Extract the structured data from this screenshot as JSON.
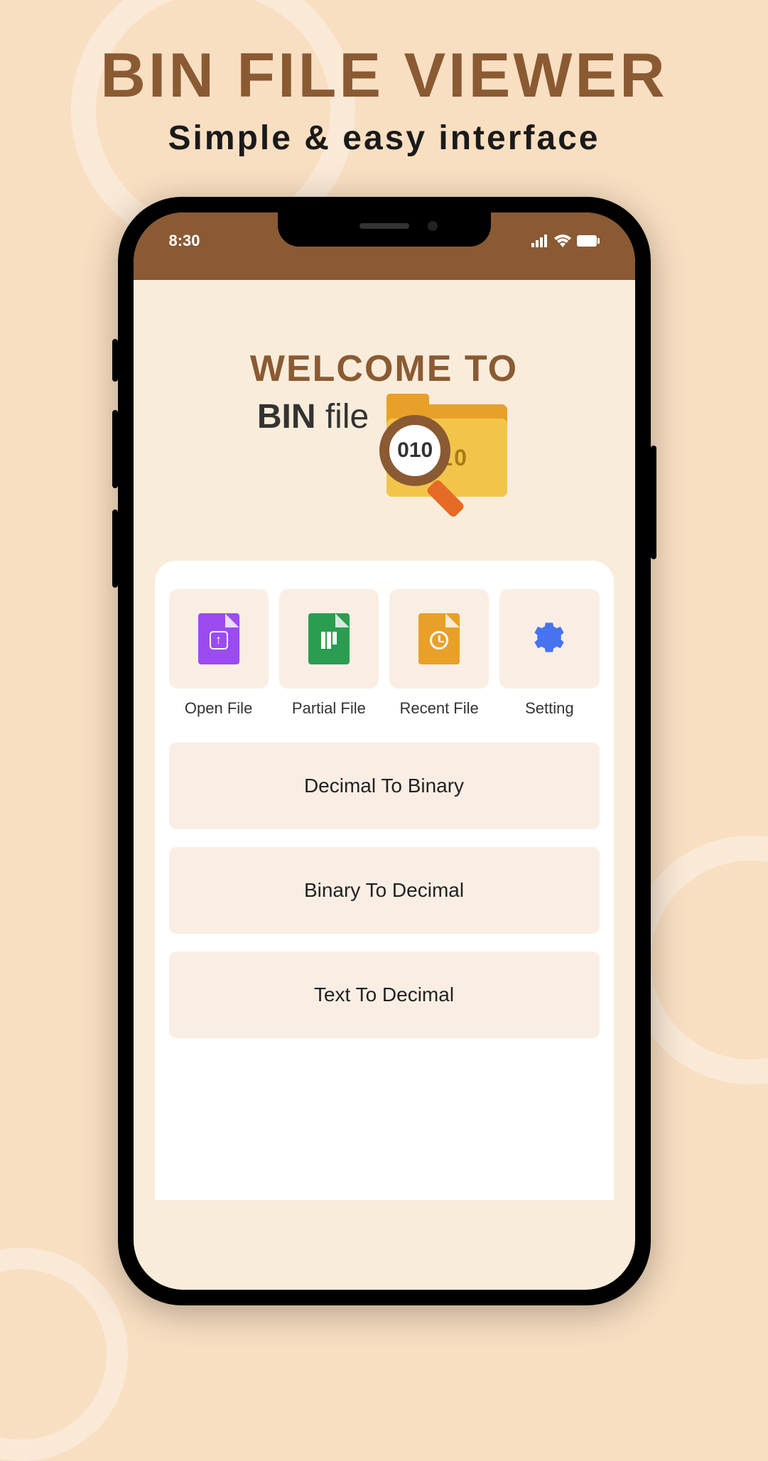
{
  "promo": {
    "title": "BIN FILE VIEWER",
    "subtitle": "Simple & easy interface"
  },
  "status": {
    "time": "8:30"
  },
  "welcome": {
    "title": "WELCOME TO",
    "bin_bold": "BIN",
    "bin_light": " file",
    "folder_front_text": "010",
    "magnifier_text": "010"
  },
  "grid": {
    "items": [
      {
        "label": "Open File",
        "icon": "file-upload-icon",
        "color": "purple"
      },
      {
        "label": "Partial File",
        "icon": "file-chart-icon",
        "color": "green"
      },
      {
        "label": "Recent File",
        "icon": "file-clock-icon",
        "color": "orange"
      },
      {
        "label": "Setting",
        "icon": "gear-icon",
        "color": "blue"
      }
    ]
  },
  "list": {
    "items": [
      {
        "label": "Decimal To Binary"
      },
      {
        "label": "Binary To Decimal"
      },
      {
        "label": "Text To Decimal"
      }
    ]
  }
}
